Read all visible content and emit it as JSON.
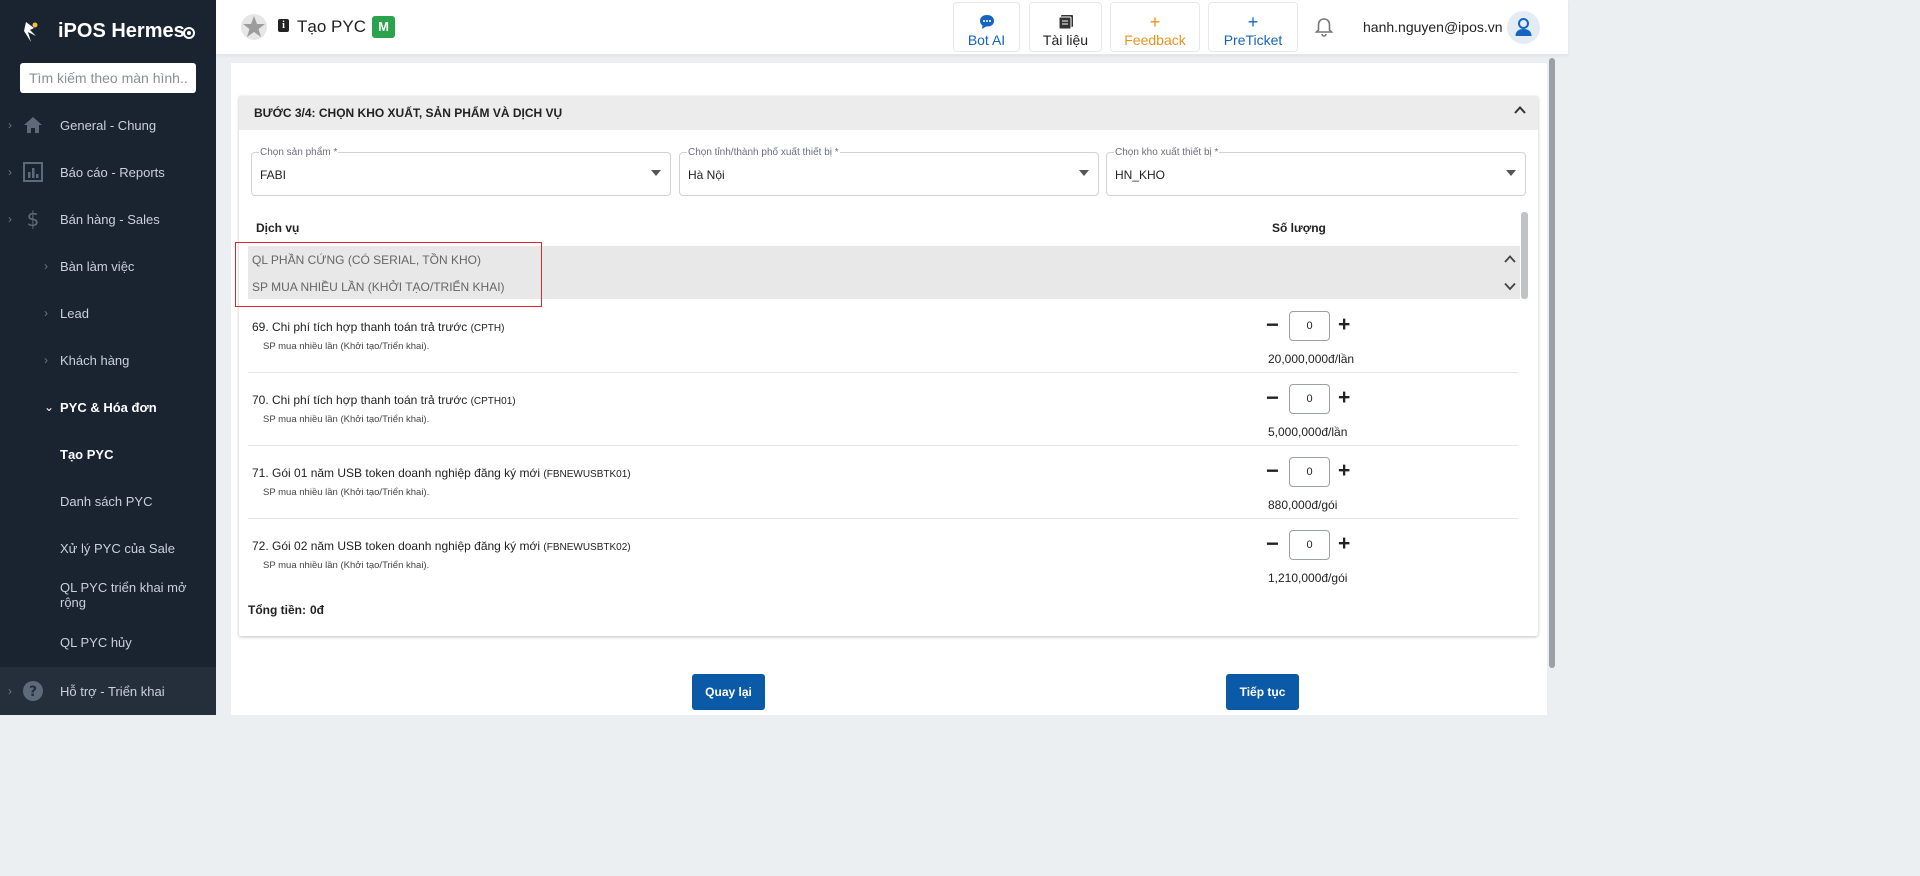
{
  "app": {
    "name": "iPOS Hermes"
  },
  "search": {
    "placeholder": "Tìm kiếm theo màn hình..."
  },
  "sidebar": {
    "items": [
      {
        "label": "General - Chung",
        "icon": "home-icon"
      },
      {
        "label": "Báo cáo - Reports",
        "icon": "report-icon"
      },
      {
        "label": "Bán hàng - Sales",
        "icon": "dollar-icon"
      },
      {
        "label": "Bàn làm việc"
      },
      {
        "label": "Lead"
      },
      {
        "label": "Khách hàng"
      },
      {
        "label": "PYC & Hóa đơn"
      },
      {
        "label": "Tạo PYC"
      },
      {
        "label": "Danh sách PYC"
      },
      {
        "label": "Xử lý PYC của Sale"
      },
      {
        "label": "QL PYC triển khai mở rộng"
      },
      {
        "label": "QL PYC hủy"
      },
      {
        "label": "Hỗ trợ - Triển khai",
        "icon": "help-icon"
      }
    ]
  },
  "header": {
    "title": "Tạo PYC",
    "badge": "M",
    "buttons": {
      "bot_ai": "Bot AI",
      "docs": "Tài liệu",
      "feedback": "Feedback",
      "preticket": "PreTicket"
    },
    "user_email": "hanh.nguyen@ipos.vn"
  },
  "step": {
    "title": "BƯỚC 3/4: CHỌN KHO XUẤT, SẢN PHẨM VÀ DỊCH VỤ"
  },
  "fields": {
    "product": {
      "label": "Chọn sản phẩm *",
      "value": "FABI"
    },
    "province": {
      "label": "Chọn tỉnh/thành phố xuất thiết bị *",
      "value": "Hà Nội"
    },
    "warehouse": {
      "label": "Chọn kho xuất thiết bị *",
      "value": "HN_KHO"
    }
  },
  "table": {
    "col_service": "Dịch vụ",
    "col_qty": "Số lượng"
  },
  "groups": [
    "QL PHẦN CỨNG (CÓ SERIAL, TỒN KHO)",
    "SP MUA NHIỀU LẦN (KHỞI TẠO/TRIỂN KHAI)"
  ],
  "services": [
    {
      "name": "69. Chi phí tích hợp thanh toán trả trước",
      "code": "(CPTH)",
      "sub": "SP mua nhiều lần (Khởi tạo/Triển khai).",
      "qty": "0",
      "price": "20,000,000đ/lần"
    },
    {
      "name": "70. Chi phí tích hợp thanh toán trả trước",
      "code": "(CPTH01)",
      "sub": "SP mua nhiều lần (Khởi tạo/Triển khai).",
      "qty": "0",
      "price": "5,000,000đ/lần"
    },
    {
      "name": "71. Gói 01 năm USB token doanh nghiệp đăng ký mới",
      "code": "(FBNEWUSBTK01)",
      "sub": "SP mua nhiều lần (Khởi tạo/Triển khai).",
      "qty": "0",
      "price": "880,000đ/gói"
    },
    {
      "name": "72. Gói 02 năm USB token doanh nghiệp đăng ký mới",
      "code": "(FBNEWUSBTK02)",
      "sub": "SP mua nhiều lần (Khởi tạo/Triển khai).",
      "qty": "0",
      "price": "1,210,000đ/gói"
    }
  ],
  "total": {
    "label": "Tổng tiền:",
    "value": "0đ"
  },
  "actions": {
    "back": "Quay lại",
    "next": "Tiếp tục"
  },
  "colors": {
    "sidebar_bg": "#1a2330",
    "primary": "#0b5aa8",
    "badge": "#2ba24c",
    "feedback": "#f0901e",
    "highlight": "#e0262b"
  }
}
